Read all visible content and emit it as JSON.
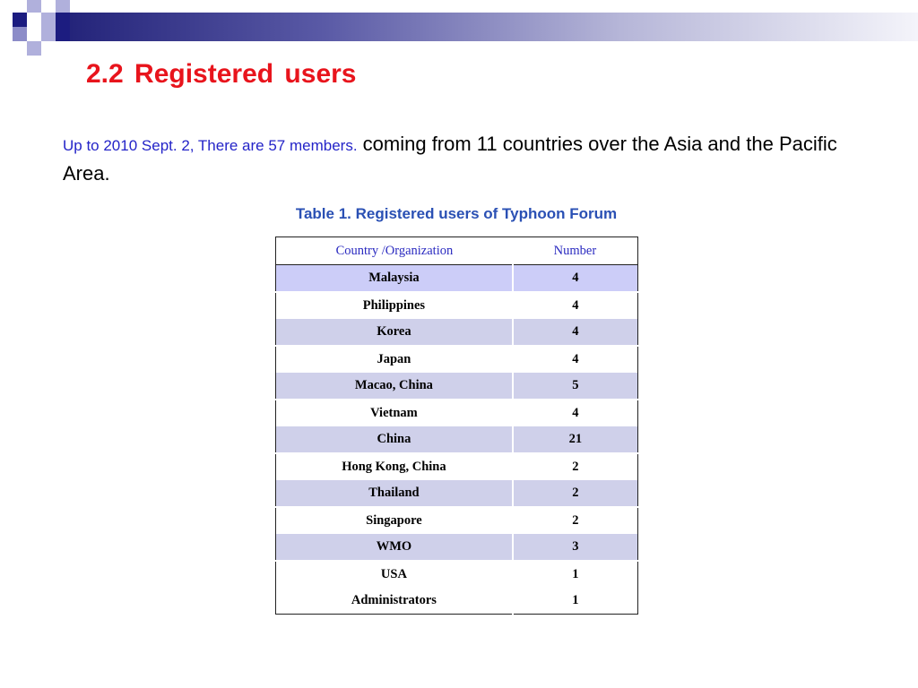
{
  "slide": {
    "title": "2.2  Registered users",
    "intro_blue": "Up to 2010 Sept. 2, There are 57 members.",
    "intro_black": " coming from 11 countries over the Asia and the Pacific Area.",
    "table_caption": "Table 1. Registered users of Typhoon Forum"
  },
  "table": {
    "headers": [
      "Country /Organization",
      "Number"
    ],
    "rows": [
      [
        "Malaysia",
        "4"
      ],
      [
        "Philippines",
        "4"
      ],
      [
        "Korea",
        "4"
      ],
      [
        "Japan",
        "4"
      ],
      [
        "Macao, China",
        "5"
      ],
      [
        "Vietnam",
        "4"
      ],
      [
        "China",
        "21"
      ],
      [
        "Hong Kong, China",
        "2"
      ],
      [
        "Thailand",
        "2"
      ],
      [
        "Singapore",
        "2"
      ],
      [
        "WMO",
        "3"
      ],
      [
        "USA",
        "1"
      ],
      [
        "Administrators",
        "1"
      ]
    ]
  },
  "colors": {
    "title": "#e8141c",
    "intro_blue": "#2424c8",
    "caption": "#2a50b4",
    "header_text": "#2a2ac0",
    "row_shade": "#cfd0ea",
    "header_bar": "#24247a"
  }
}
